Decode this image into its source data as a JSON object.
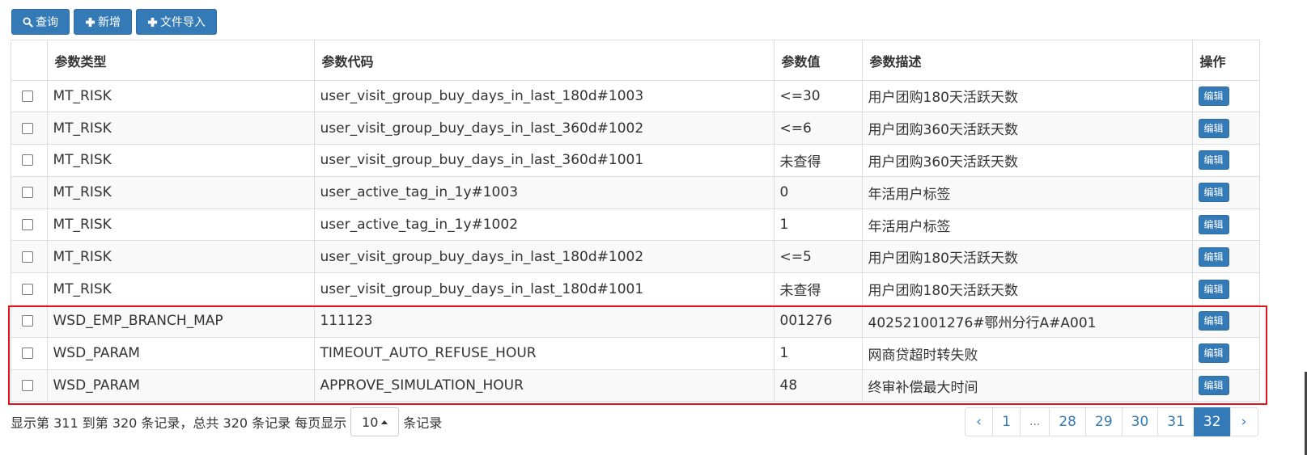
{
  "toolbar": {
    "query_label": "查询",
    "add_label": "新增",
    "import_label": "文件导入"
  },
  "table": {
    "headers": {
      "type": "参数类型",
      "code": "参数代码",
      "value": "参数值",
      "desc": "参数描述",
      "op": "操作"
    },
    "edit_label": "编辑",
    "rows": [
      {
        "type": "MT_RISK",
        "code": "user_visit_group_buy_days_in_last_180d#1003",
        "value": "<=30",
        "desc": "用户团购180天活跃天数"
      },
      {
        "type": "MT_RISK",
        "code": "user_visit_group_buy_days_in_last_360d#1002",
        "value": "<=6",
        "desc": "用户团购360天活跃天数"
      },
      {
        "type": "MT_RISK",
        "code": "user_visit_group_buy_days_in_last_360d#1001",
        "value": "未查得",
        "desc": "用户团购360天活跃天数"
      },
      {
        "type": "MT_RISK",
        "code": "user_active_tag_in_1y#1003",
        "value": "0",
        "desc": "年活用户标签"
      },
      {
        "type": "MT_RISK",
        "code": "user_active_tag_in_1y#1002",
        "value": "1",
        "desc": "年活用户标签"
      },
      {
        "type": "MT_RISK",
        "code": "user_visit_group_buy_days_in_last_180d#1002",
        "value": "<=5",
        "desc": "用户团购180天活跃天数"
      },
      {
        "type": "MT_RISK",
        "code": "user_visit_group_buy_days_in_last_180d#1001",
        "value": "未查得",
        "desc": "用户团购180天活跃天数"
      },
      {
        "type": "WSD_EMP_BRANCH_MAP",
        "code": "111123",
        "value": "001276",
        "desc": "402521001276#鄂州分行A#A001"
      },
      {
        "type": "WSD_PARAM",
        "code": "TIMEOUT_AUTO_REFUSE_HOUR",
        "value": "1",
        "desc": "网商贷超时转失败"
      },
      {
        "type": "WSD_PARAM",
        "code": "APPROVE_SIMULATION_HOUR",
        "value": "48",
        "desc": "终审补偿最大时间"
      }
    ]
  },
  "footer": {
    "summary": "显示第 311 到第 320 条记录，总共 320 条记录 每页显示",
    "page_size": "10",
    "suffix": "条记录"
  },
  "pagination": {
    "prev": "‹",
    "items": [
      "1",
      "...",
      "28",
      "29",
      "30",
      "31",
      "32"
    ],
    "active": "32",
    "next": "›"
  },
  "colors": {
    "primary": "#337ab7",
    "highlight_border": "#e0141b"
  }
}
